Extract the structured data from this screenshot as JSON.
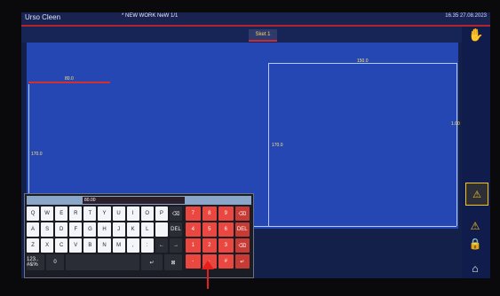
{
  "titlebar": {
    "app_title": "Urso Cleen",
    "file_label": "* NEW WORK NeW 1/1",
    "time_label": "16.35 27.08.2023"
  },
  "tabs": [
    {
      "label": "Sket 1"
    }
  ],
  "workarea": {
    "dim_top_left": "80.0",
    "dim_left": "170.0",
    "dim_center": "170.0",
    "dim_top_right": "150.0",
    "dim_right": "1.00"
  },
  "keyboard": {
    "input_value": "80.00",
    "rows_letters": [
      [
        "Q",
        "W",
        "E",
        "R",
        "T",
        "Y",
        "U",
        "I",
        "O",
        "P",
        "⌫"
      ],
      [
        "A",
        "S",
        "D",
        "F",
        "G",
        "H",
        "J",
        "K",
        "L",
        "",
        "DEL"
      ],
      [
        "Z",
        "X",
        "C",
        "V",
        "B",
        "N",
        "M",
        ",",
        ":",
        "←",
        "→"
      ]
    ],
    "bottom_left": "123.. #&%",
    "bottom_mid": "0",
    "bottom_right": "↵",
    "numpad": [
      [
        "7",
        "8",
        "9",
        "⌫"
      ],
      [
        "4",
        "5",
        "6",
        "DEL"
      ],
      [
        "1",
        "2",
        "3",
        "⌫"
      ],
      [
        "-",
        "·",
        "#",
        "↵"
      ]
    ]
  },
  "icons": {
    "right_panel": [
      "hand-icon",
      "warning-icon",
      "warning-icon",
      "lock-icon",
      "home-icon"
    ]
  },
  "colors": {
    "accent_red": "#d32f2f",
    "canvas_blue": "#2447b4",
    "warning_yellow": "#f5c518"
  }
}
